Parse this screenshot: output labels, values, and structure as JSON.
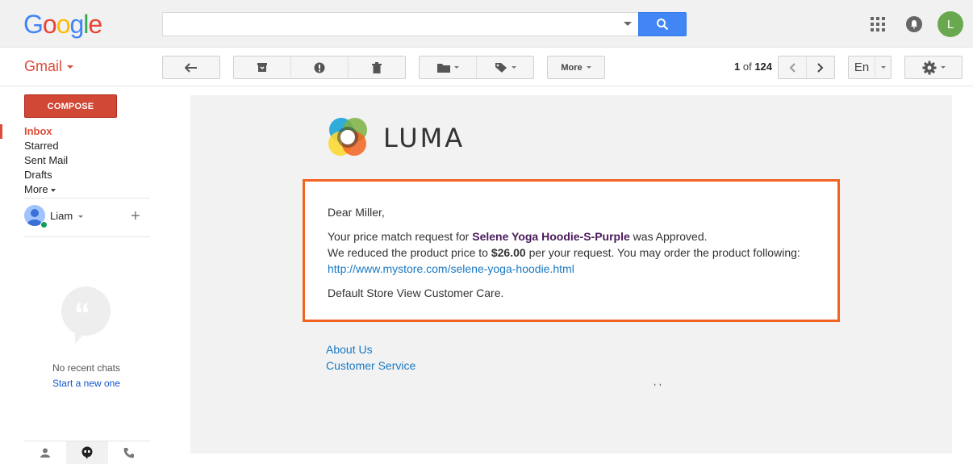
{
  "brand": {
    "google": [
      "G",
      "o",
      "o",
      "g",
      "l",
      "e"
    ],
    "google_colors": [
      "#4285f4",
      "#ea4335",
      "#fbbc05",
      "#4285f4",
      "#34a853",
      "#ea4335"
    ]
  },
  "header": {
    "search_value": "",
    "user_initial": "L"
  },
  "toolbar": {
    "app_label": "Gmail",
    "more_label": "More",
    "pager_current": "1",
    "pager_of": "of",
    "pager_total": "124",
    "lang_label": "En"
  },
  "sidebar": {
    "compose_label": "COMPOSE",
    "items": [
      {
        "label": "Inbox"
      },
      {
        "label": "Starred"
      },
      {
        "label": "Sent Mail"
      },
      {
        "label": "Drafts"
      },
      {
        "label": "More"
      }
    ],
    "hangouts_user": "Liam",
    "no_chats": "No recent chats",
    "start_new": "Start a new one"
  },
  "email": {
    "logo_text": "LUMA",
    "greeting": "Dear Miller,",
    "line1_prefix": "Your price match request for ",
    "product_name": "Selene Yoga Hoodie-S-Purple",
    "line1_suffix": " was Approved.",
    "line2_prefix": "We reduced the product price to ",
    "price": "$26.00",
    "line2_suffix": " per your request. You may order the product following:",
    "product_link": "http://www.mystore.com/selene-yoga-hoodie.html",
    "signoff": "Default Store View Customer Care.",
    "footer_links": [
      "About Us",
      "Customer Service"
    ],
    "footer_address": ", ,"
  },
  "colors": {
    "accent_red": "#dd4b39",
    "luma_orange": "#f26322",
    "link_blue": "#1979c3",
    "search_blue": "#4285f4"
  }
}
